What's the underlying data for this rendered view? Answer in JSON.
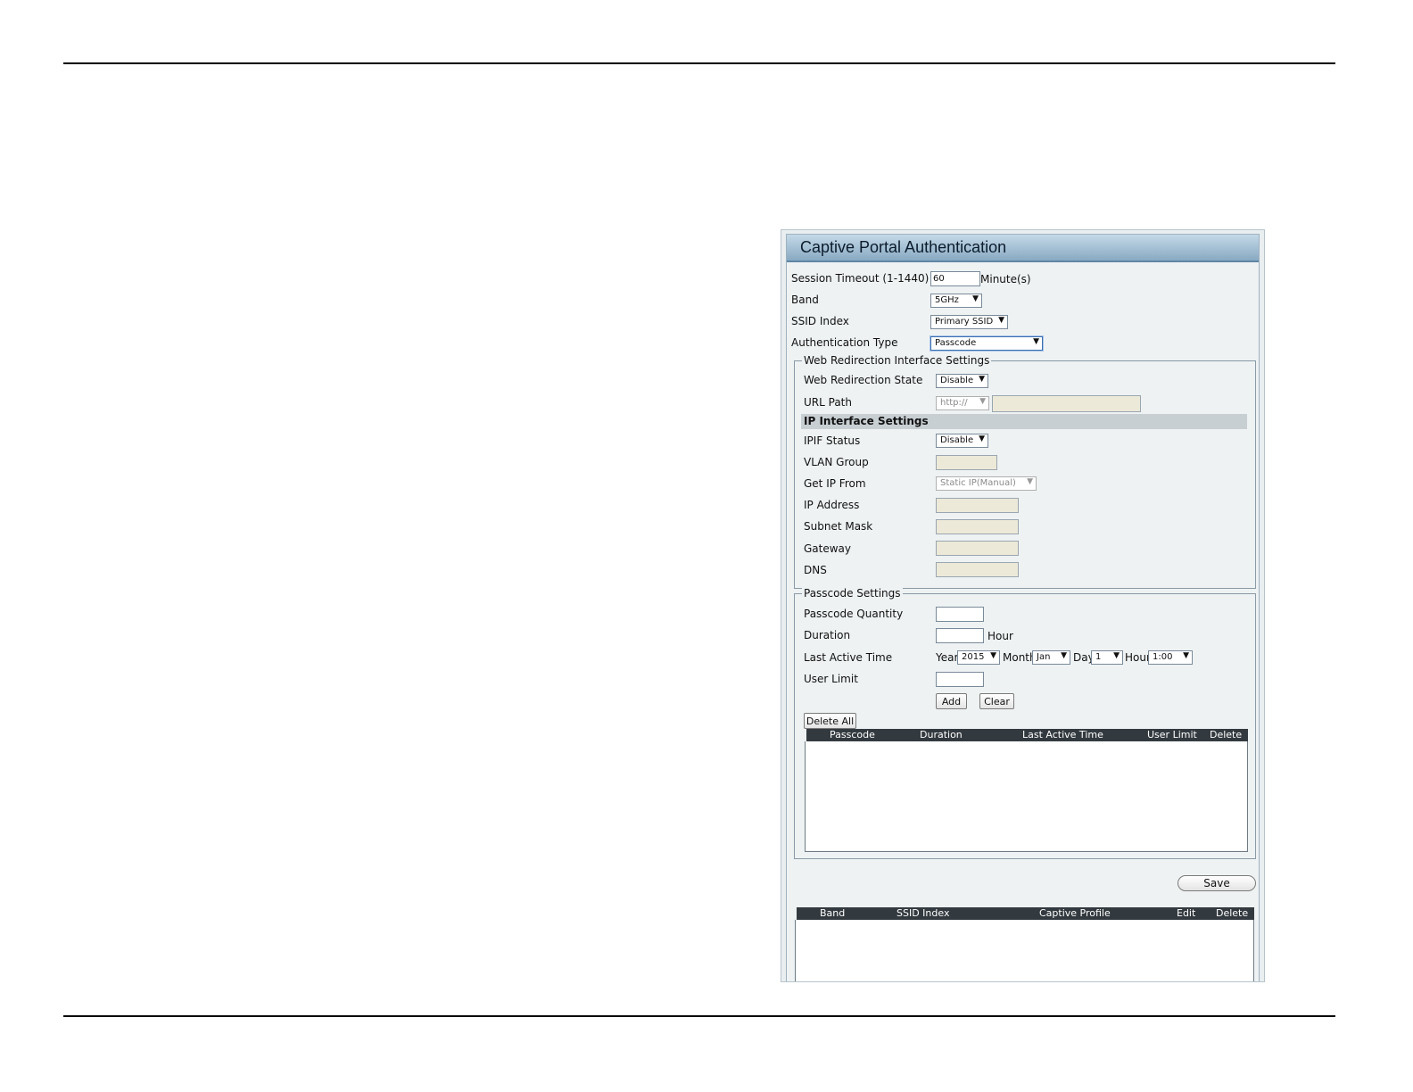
{
  "panel": {
    "title": "Captive Portal Authentication",
    "session_timeout": {
      "label": "Session Timeout (1-1440)",
      "value": "60",
      "unit": "Minute(s)"
    },
    "band": {
      "label": "Band",
      "value": "5GHz"
    },
    "ssid_index": {
      "label": "SSID Index",
      "value": "Primary SSID"
    },
    "auth_type": {
      "label": "Authentication Type",
      "value": "Passcode"
    }
  },
  "web_redirection": {
    "legend": "Web Redirection Interface Settings",
    "state": {
      "label": "Web Redirection State",
      "value": "Disable"
    },
    "url_path": {
      "label": "URL Path",
      "scheme": "http://",
      "value": ""
    }
  },
  "ip_interface": {
    "heading": "IP Interface Settings",
    "ipif_status": {
      "label": "IPIF Status",
      "value": "Disable"
    },
    "vlan_group": {
      "label": "VLAN Group",
      "value": ""
    },
    "get_ip_from": {
      "label": "Get IP From",
      "value": "Static IP(Manual)"
    },
    "ip_address": {
      "label": "IP Address",
      "value": ""
    },
    "subnet_mask": {
      "label": "Subnet Mask",
      "value": ""
    },
    "gateway": {
      "label": "Gateway",
      "value": ""
    },
    "dns": {
      "label": "DNS",
      "value": ""
    }
  },
  "passcode": {
    "legend": "Passcode Settings",
    "quantity": {
      "label": "Passcode Quantity",
      "value": ""
    },
    "duration": {
      "label": "Duration",
      "value": "",
      "unit": "Hour"
    },
    "last_active": {
      "label": "Last Active Time",
      "year_label": "Year",
      "year": "2015",
      "month_label": "Month",
      "month": "Jan",
      "day_label": "Day",
      "day": "1",
      "hour_label": "Hour",
      "hour": "1:00"
    },
    "user_limit": {
      "label": "User Limit",
      "value": ""
    },
    "add_label": "Add",
    "clear_label": "Clear",
    "delete_all_label": "Delete All",
    "table_headers": [
      "Passcode",
      "Duration",
      "Last Active Time",
      "User Limit",
      "Delete"
    ]
  },
  "save_label": "Save",
  "profile_table": {
    "headers": [
      "Band",
      "SSID Index",
      "Captive Profile",
      "Edit",
      "Delete"
    ]
  }
}
